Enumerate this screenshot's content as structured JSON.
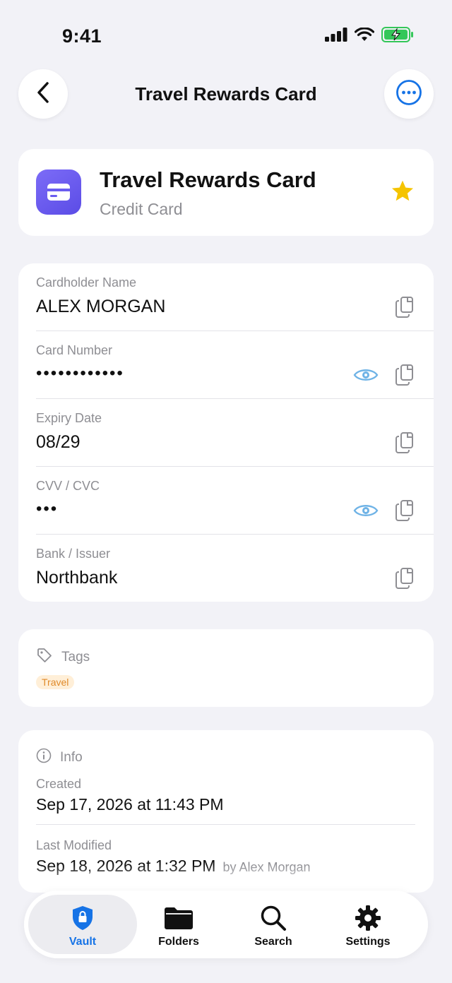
{
  "status_bar": {
    "time": "9:41"
  },
  "nav": {
    "title": "Travel Rewards Card"
  },
  "item": {
    "title": "Travel Rewards Card",
    "subtitle": "Credit Card",
    "favorite": true,
    "icon": "credit-card-icon",
    "accent": "#5b4ce6"
  },
  "fields": [
    {
      "label": "Cardholder Name",
      "value": "ALEX MORGAN",
      "masked": false
    },
    {
      "label": "Card Number",
      "value": "••••••••••••",
      "masked": true
    },
    {
      "label": "Expiry Date",
      "value": "08/29",
      "masked": false
    },
    {
      "label": "CVV / CVC",
      "value": "•••",
      "masked": true
    },
    {
      "label": "Bank / Issuer",
      "value": "Northbank",
      "masked": false
    }
  ],
  "tags": {
    "heading": "Tags",
    "items": [
      "Travel"
    ]
  },
  "info": {
    "heading": "Info",
    "created_label": "Created",
    "created_value": "Sep 17, 2026 at 11:43 PM",
    "modified_label": "Last Modified",
    "modified_value": "Sep 18, 2026 at 1:32 PM",
    "modified_by": "by Alex Morgan"
  },
  "tabbar": {
    "tabs": [
      {
        "label": "Vault",
        "icon": "shield-lock-icon",
        "active": true
      },
      {
        "label": "Folders",
        "icon": "folder-icon",
        "active": false
      },
      {
        "label": "Search",
        "icon": "search-icon",
        "active": false
      },
      {
        "label": "Settings",
        "icon": "gear-icon",
        "active": false
      }
    ]
  },
  "colors": {
    "accent": "#1673e6",
    "star": "#f5c400",
    "tag_bg": "#ffefd8",
    "tag_fg": "#e08a2a",
    "eye": "#6fb3e6"
  }
}
